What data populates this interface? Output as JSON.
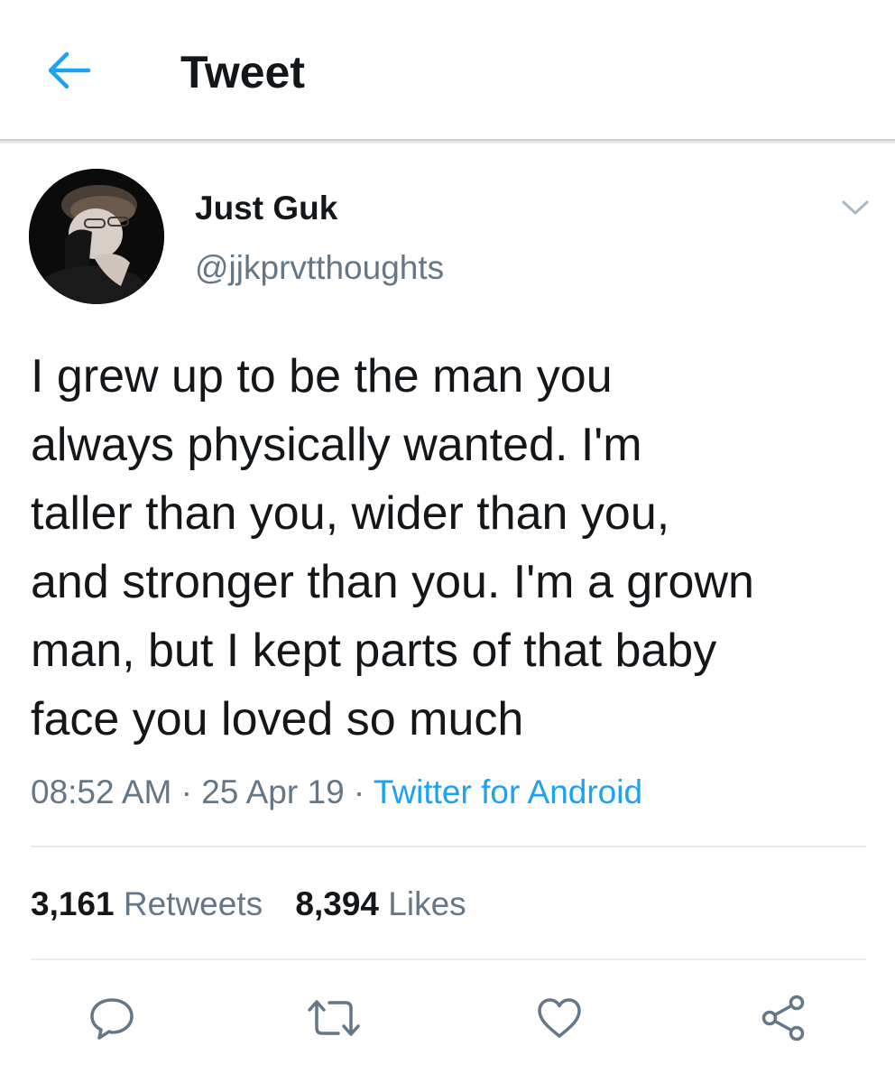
{
  "appbar": {
    "title": "Tweet",
    "back_icon": "arrow-left-icon"
  },
  "author": {
    "display_name": "Just Guk",
    "handle": "@jjkprvtthoughts",
    "avatar": "profile-photo",
    "menu_icon": "chevron-down-icon"
  },
  "tweet": {
    "text": "I grew up to be the man you\nalways physically wanted. I'm\ntaller than you, wider than you,\nand stronger than you. I'm a grown\nman, but I kept parts of that baby\nface you loved so much",
    "time": "08:52 AM",
    "date": "25 Apr 19",
    "separator": "·",
    "source": "Twitter for Android"
  },
  "stats": {
    "retweets_count": "3,161",
    "retweets_label": "Retweets",
    "likes_count": "8,394",
    "likes_label": "Likes"
  },
  "actions": {
    "reply_icon": "reply-icon",
    "retweet_icon": "retweet-icon",
    "like_icon": "heart-icon",
    "share_icon": "share-icon"
  },
  "colors": {
    "accent": "#1da1f2",
    "text": "#14171a",
    "secondary": "#657786",
    "divider": "#e6ecf0"
  }
}
